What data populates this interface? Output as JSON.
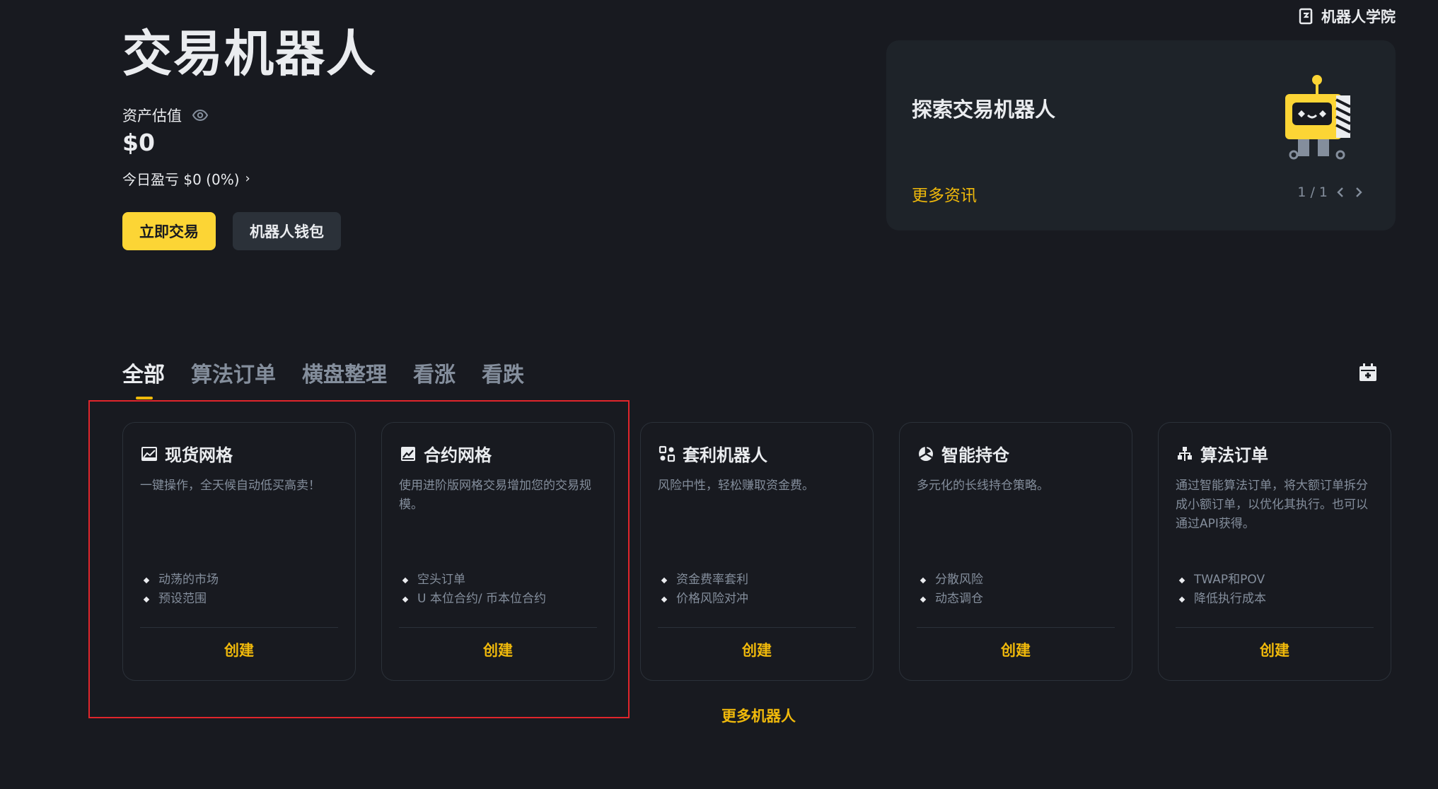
{
  "academy": {
    "label": "机器人学院",
    "icon": "academy-book-icon"
  },
  "header": {
    "title": "交易机器人",
    "asset_label": "资产估值",
    "asset_value": "$0",
    "pnl_text": "今日盈亏 $0 (0%)",
    "pnl_arrow": "›",
    "trade_button": "立即交易",
    "wallet_button": "机器人钱包"
  },
  "explore": {
    "title": "探索交易机器人",
    "more_link": "更多资讯",
    "pager": "1 / 1"
  },
  "tabs": [
    {
      "label": "全部",
      "active": true
    },
    {
      "label": "算法订单"
    },
    {
      "label": "横盘整理"
    },
    {
      "label": "看涨"
    },
    {
      "label": "看跌"
    }
  ],
  "cards": [
    {
      "title": "现货网格",
      "icon": "spot-grid-icon",
      "desc": "一键操作，全天候自动低买高卖！",
      "features": [
        "动荡的市场",
        "预设范围"
      ],
      "cta": "创建"
    },
    {
      "title": "合约网格",
      "icon": "futures-grid-icon",
      "desc": "使用进阶版网格交易增加您的交易规模。",
      "features": [
        "空头订单",
        "U 本位合约/ 币本位合约"
      ],
      "cta": "创建"
    },
    {
      "title": "套利机器人",
      "icon": "arbitrage-icon",
      "desc": "风险中性，轻松赚取资金费。",
      "features": [
        "资金费率套利",
        "价格风险对冲"
      ],
      "cta": "创建"
    },
    {
      "title": "智能持仓",
      "icon": "rebalance-icon",
      "desc": "多元化的长线持仓策略。",
      "features": [
        "分散风险",
        "动态调仓"
      ],
      "cta": "创建"
    },
    {
      "title": "算法订单",
      "icon": "algo-order-icon",
      "desc": "通过智能算法订单，将大额订单拆分成小额订单，以优化其执行。也可以通过API获得。",
      "features": [
        "TWAP和POV",
        "降低执行成本"
      ],
      "cta": "创建"
    }
  ],
  "more_robots": "更多机器人",
  "colors": {
    "accent": "#f0b90b",
    "button_yellow": "#fcd535",
    "background": "#181a20",
    "highlight": "#e0252b"
  }
}
